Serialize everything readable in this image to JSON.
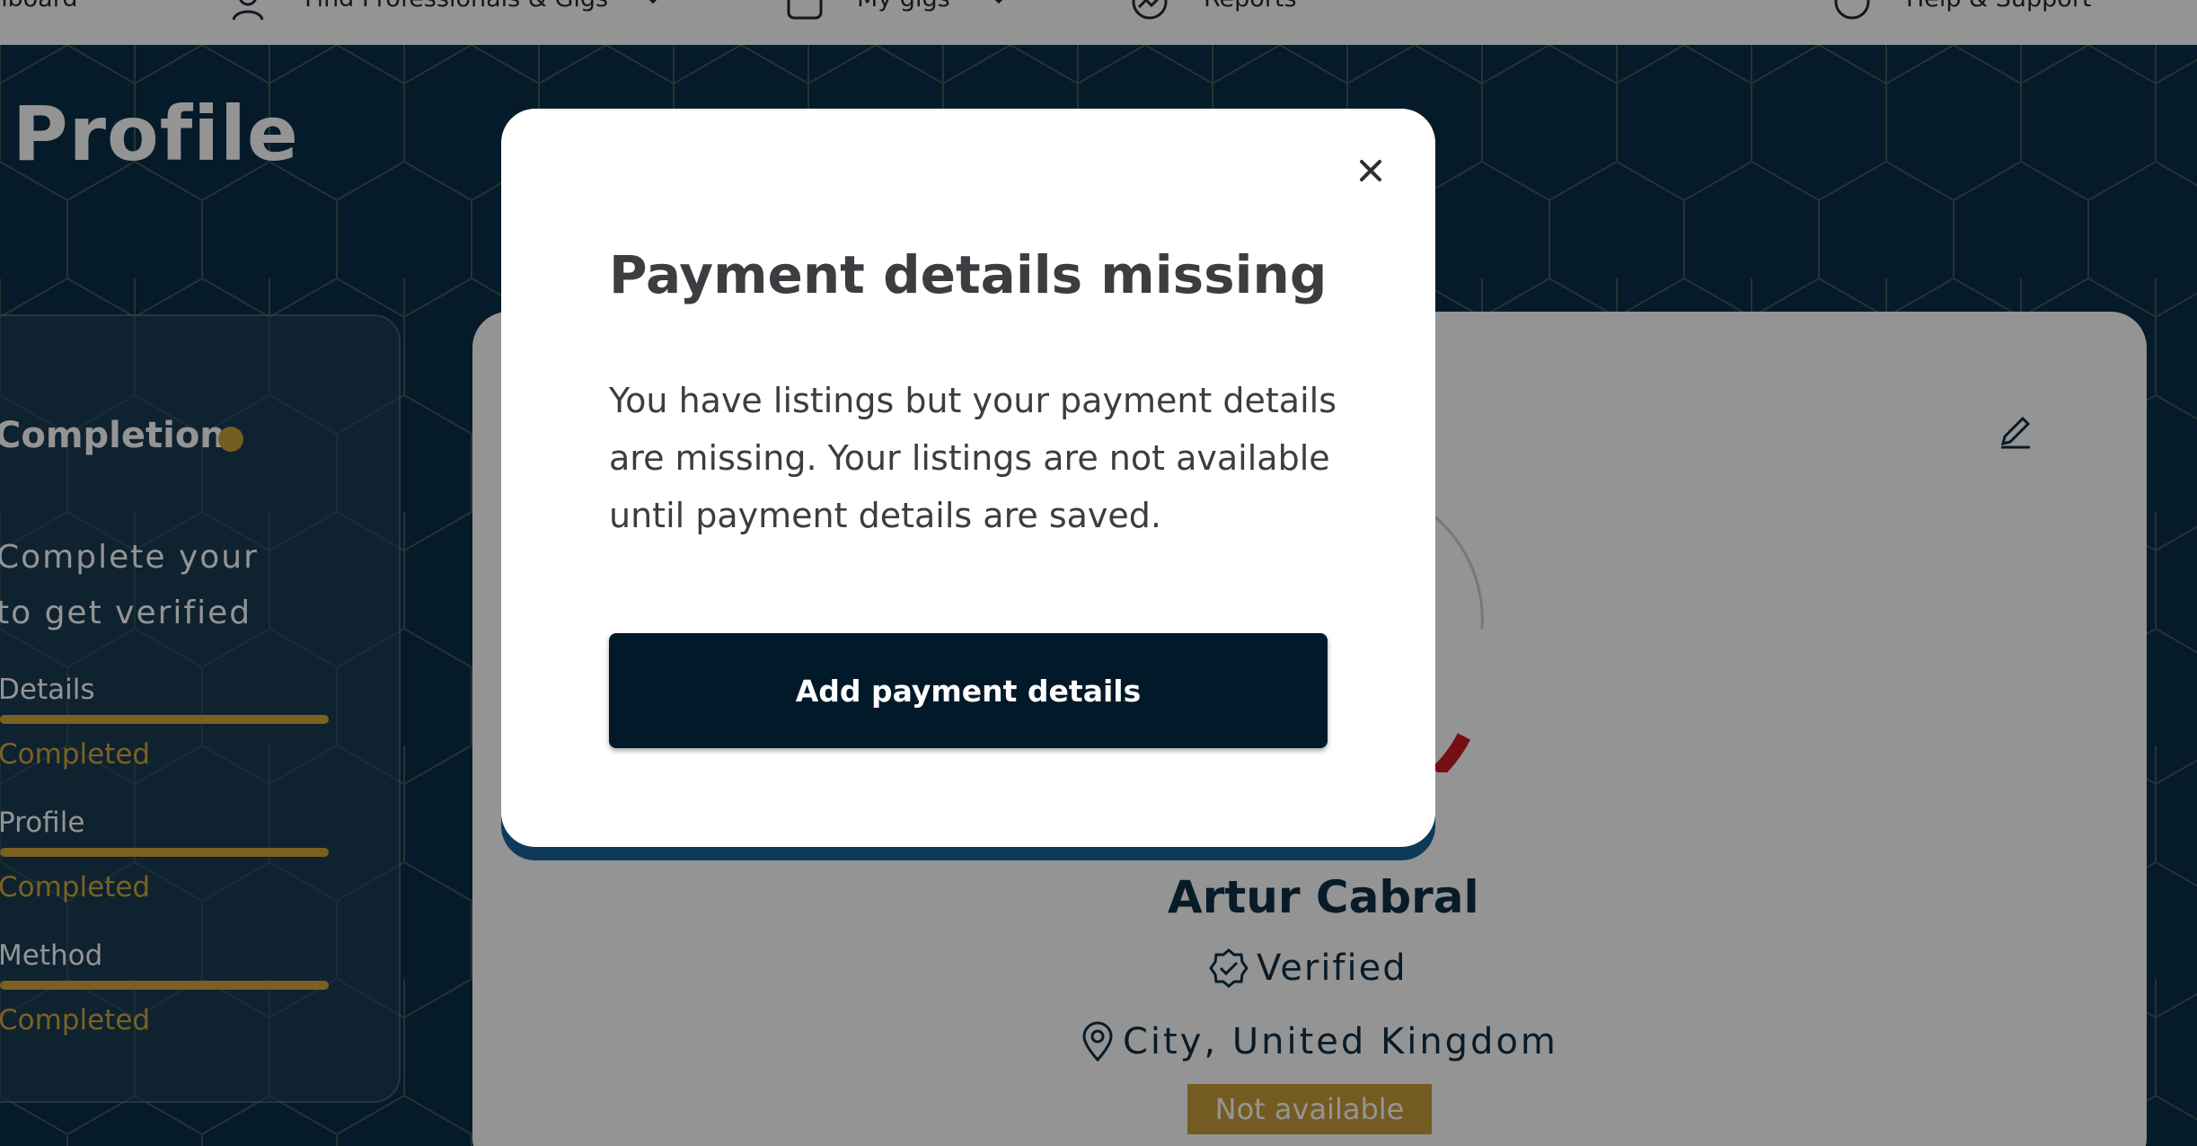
{
  "nav": {
    "items": [
      {
        "label": "Dashboard",
        "icon": "grid-icon"
      },
      {
        "label": "Find Professionals & Gigs",
        "icon": "user-icon"
      },
      {
        "label": "My gigs",
        "icon": "briefcase-icon"
      },
      {
        "label": "Reports",
        "icon": "trend-icon"
      },
      {
        "label": "Help & Support",
        "icon": "help-icon"
      }
    ]
  },
  "page": {
    "title": "Profile"
  },
  "completion": {
    "title": "Completion",
    "description_line1": "Complete your",
    "description_line2": "to get verified",
    "steps": [
      {
        "label": "Details",
        "status": "Completed",
        "progress": 1.0
      },
      {
        "label": "Profile",
        "status": "Completed",
        "progress": 1.0
      },
      {
        "label": "Method",
        "status": "Completed",
        "progress": 1.0
      }
    ]
  },
  "profile": {
    "name": "Artur Cabral",
    "verified": "Verified",
    "location": "City, United Kingdom",
    "availability": "Not available"
  },
  "modal": {
    "title": "Payment details missing",
    "body": "You have listings but your payment details are missing. Your listings are not available until payment details are saved.",
    "cta": "Add payment details"
  },
  "colors": {
    "brand_navy": "#0c2f47",
    "accent_gold": "#d3a83a",
    "cta_dark": "#021929"
  }
}
